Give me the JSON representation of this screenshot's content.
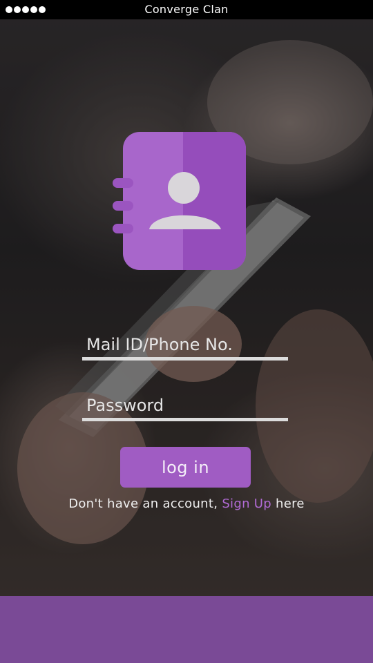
{
  "status_bar": {
    "title": "Converge Clan",
    "signal_dots": 5
  },
  "login_form": {
    "email_placeholder": "Mail ID/Phone No.",
    "password_placeholder": "Password",
    "login_label": "log in"
  },
  "signup": {
    "prefix": "Don't have an account,",
    "link_label": "Sign Up",
    "suffix": "here"
  },
  "colors": {
    "accent": "#a05cc3",
    "accent_dark": "#8e4db5",
    "footer": "#7a4a96",
    "link": "#b26bd6"
  },
  "icons": {
    "logo": "contact-book-icon",
    "signal": "signal-strength-icon"
  }
}
